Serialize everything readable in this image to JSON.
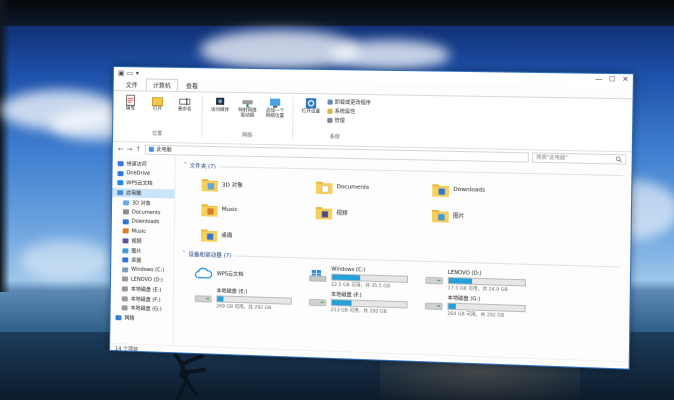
{
  "window": {
    "quick_access": "▣ ▭ ▾",
    "controls": [
      "—",
      "☐",
      "✕"
    ],
    "tabs": [
      {
        "label": "文件",
        "active": false
      },
      {
        "label": "计算机",
        "active": true
      },
      {
        "label": "查看",
        "active": false
      }
    ],
    "ribbon": {
      "groups": [
        {
          "name": "位置",
          "buttons": [
            "属性",
            "打开",
            "重命名"
          ]
        },
        {
          "name": "网络",
          "buttons": [
            "访问媒体",
            "映射网络驱动器",
            "添加一个网络位置"
          ]
        },
        {
          "name": "系统",
          "buttons": [
            "打开设置"
          ],
          "items": [
            "卸载或更改程序",
            "系统属性",
            "管理"
          ]
        }
      ]
    },
    "address": {
      "back": "←",
      "forward": "→",
      "up": "↑",
      "path": "此电脑",
      "search_placeholder": "搜索\"此电脑\"",
      "search_icon": "search-icon"
    },
    "nav": [
      {
        "label": "快速访问",
        "icon": "star-icon",
        "color": "#3d7ad6",
        "child": false,
        "selected": false
      },
      {
        "label": "OneDrive",
        "icon": "cloud-icon",
        "color": "#2e78d2",
        "child": false,
        "selected": false
      },
      {
        "label": "WPS云文档",
        "icon": "cloud-icon",
        "color": "#1f8be0",
        "child": false,
        "selected": false
      },
      {
        "label": "此电脑",
        "icon": "computer-icon",
        "color": "#4a90d9",
        "child": false,
        "selected": true
      },
      {
        "label": "3D 对象",
        "icon": "cube-icon",
        "color": "#6aa9e6",
        "child": true,
        "selected": false
      },
      {
        "label": "Documents",
        "icon": "document-icon",
        "color": "#8c8c8c",
        "child": true,
        "selected": false
      },
      {
        "label": "Downloads",
        "icon": "download-icon",
        "color": "#2e78d2",
        "child": true,
        "selected": false
      },
      {
        "label": "Music",
        "icon": "music-icon",
        "color": "#e07b1f",
        "child": true,
        "selected": false
      },
      {
        "label": "视频",
        "icon": "video-icon",
        "color": "#5a5a9a",
        "child": true,
        "selected": false
      },
      {
        "label": "图片",
        "icon": "picture-icon",
        "color": "#3c9bd8",
        "child": true,
        "selected": false
      },
      {
        "label": "桌面",
        "icon": "desktop-icon",
        "color": "#2e78d2",
        "child": true,
        "selected": false
      },
      {
        "label": "Windows (C:)",
        "icon": "drive-icon",
        "color": "#7f9db8",
        "child": true,
        "selected": false
      },
      {
        "label": "LENOVO (D:)",
        "icon": "drive-icon",
        "color": "#9a9a9a",
        "child": true,
        "selected": false
      },
      {
        "label": "本地磁盘 (E:)",
        "icon": "drive-icon",
        "color": "#9a9a9a",
        "child": true,
        "selected": false
      },
      {
        "label": "本地磁盘 (F:)",
        "icon": "drive-icon",
        "color": "#9a9a9a",
        "child": true,
        "selected": false
      },
      {
        "label": "本地磁盘 (G:)",
        "icon": "drive-icon",
        "color": "#9a9a9a",
        "child": true,
        "selected": false
      },
      {
        "label": "网络",
        "icon": "network-icon",
        "color": "#3d7ad6",
        "child": false,
        "selected": false
      }
    ],
    "folders_header": "文件夹 (7)",
    "folders": [
      {
        "label": "3D 对象",
        "badge": "cube"
      },
      {
        "label": "Documents",
        "badge": "doc"
      },
      {
        "label": "Downloads",
        "badge": "down"
      },
      {
        "label": "Music",
        "badge": "music"
      },
      {
        "label": "视频",
        "badge": "video"
      },
      {
        "label": "图片",
        "badge": "pic"
      },
      {
        "label": "桌面",
        "badge": "desk"
      }
    ],
    "drives_header": "设备和驱动器 (7)",
    "drives": [
      {
        "label": "WPS云文档",
        "type": "cloud",
        "space": "",
        "fill": 0
      },
      {
        "label": "Windows (C:)",
        "type": "windows",
        "space": "22.5 GB 可用，共 35.5 GB",
        "fill": 0.37
      },
      {
        "label": "LENOVO (D:)",
        "type": "disk",
        "space": "17.3 GB 可用，共 24.9 GB",
        "fill": 0.31
      },
      {
        "label": "本地磁盘 (E:)",
        "type": "disk",
        "space": "269 GB 可用，共 292 GB",
        "fill": 0.08
      },
      {
        "label": "本地磁盘 (F:)",
        "type": "disk",
        "space": "213 GB 可用，共 292 GB",
        "fill": 0.27
      },
      {
        "label": "本地磁盘 (G:)",
        "type": "disk",
        "space": "264 GB 可用，共 292 GB",
        "fill": 0.1
      }
    ],
    "status": "14 个项目"
  }
}
